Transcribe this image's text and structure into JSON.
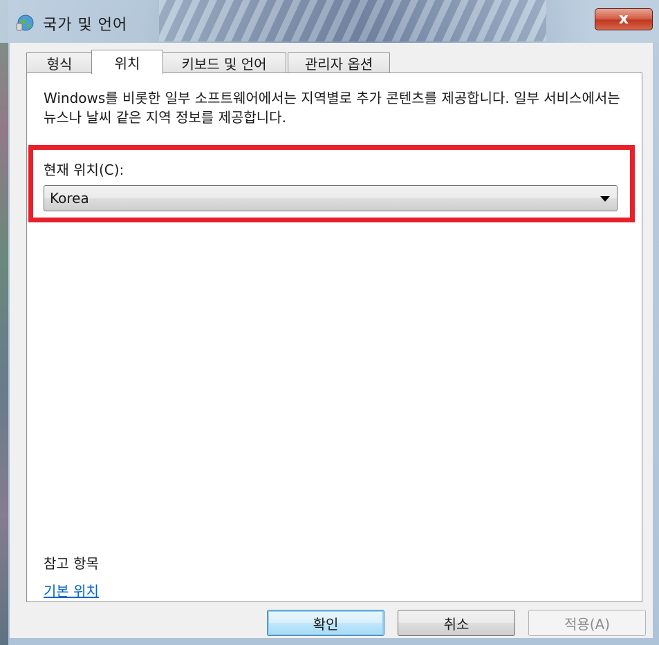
{
  "window": {
    "title": "국가 및 언어",
    "close_glyph": "x"
  },
  "tabs": [
    {
      "label": "형식",
      "active": false
    },
    {
      "label": "위치",
      "active": true
    },
    {
      "label": "키보드 및 언어",
      "active": false
    },
    {
      "label": "관리자 옵션",
      "active": false
    }
  ],
  "location": {
    "description": "Windows를 비롯한 일부 소프트웨어에서는 지역별로 추가 콘텐츠를 제공합니다. 일부 서비스에서는 뉴스나 날씨 같은 지역 정보를 제공합니다.",
    "current_label": "현재 위치(C):",
    "current_value": "Korea"
  },
  "see_also": {
    "heading": "참고 항목",
    "link": "기본 위치"
  },
  "buttons": {
    "ok": "확인",
    "cancel": "취소",
    "apply": "적용(A)"
  },
  "colors": {
    "highlight": "#e8202a",
    "link": "#0066cc"
  }
}
